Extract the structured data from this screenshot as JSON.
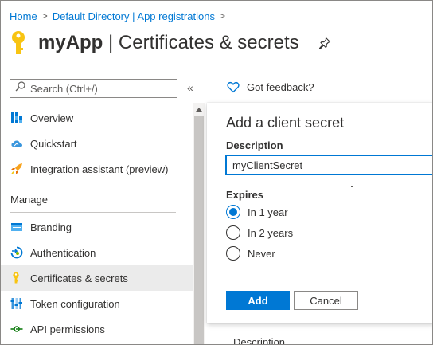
{
  "breadcrumb": {
    "items": [
      "Home",
      "Default Directory | App registrations"
    ],
    "separator": ">"
  },
  "header": {
    "app_name": "myApp",
    "page_title": "| Certificates & secrets"
  },
  "search": {
    "placeholder": "Search (Ctrl+/)"
  },
  "collapse_label": "«",
  "sidebar": {
    "items": [
      {
        "label": "Overview",
        "icon": "overview-grid-icon"
      },
      {
        "label": "Quickstart",
        "icon": "cloud-icon"
      },
      {
        "label": "Integration assistant (preview)",
        "icon": "rocket-icon"
      }
    ],
    "section_label": "Manage",
    "manage_items": [
      {
        "label": "Branding",
        "icon": "branding-icon"
      },
      {
        "label": "Authentication",
        "icon": "authentication-icon"
      },
      {
        "label": "Certificates & secrets",
        "icon": "key-icon",
        "active": true
      },
      {
        "label": "Token configuration",
        "icon": "token-bars-icon"
      },
      {
        "label": "API permissions",
        "icon": "api-permissions-icon"
      }
    ]
  },
  "feedback": {
    "label": "Got feedback?"
  },
  "dialog": {
    "title": "Add a client secret",
    "description_label": "Description",
    "description_value": "myClientSecret",
    "expires_label": "Expires",
    "options": [
      "In 1 year",
      "In 2 years",
      "Never"
    ],
    "selected_option": "In 1 year",
    "add_label": "Add",
    "cancel_label": "Cancel"
  },
  "background": {
    "partial_text": "Description"
  },
  "colors": {
    "accent": "#0078d4",
    "key_yellow": "#f8c412",
    "active_nav_bg": "#ebebeb"
  }
}
